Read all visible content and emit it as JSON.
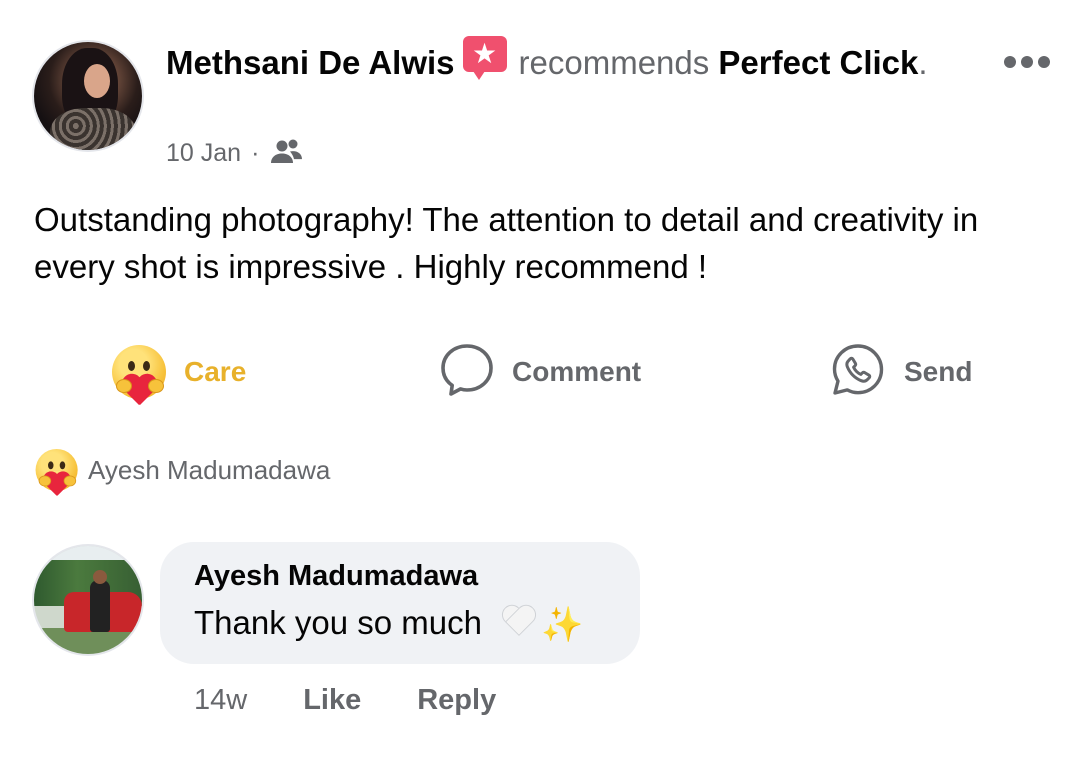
{
  "post": {
    "author_name": "Methsani De Alwis",
    "recommends_word": "recommends",
    "page_name": "Perfect Click",
    "trailing_period": ".",
    "date": "10 Jan",
    "separator": "·",
    "audience_icon": "friends-icon",
    "more_icon": "more-horizontal-icon",
    "body": "Outstanding photography! The attention to detail and creativity in every shot is impressive . Highly recommend !"
  },
  "actions": {
    "care_label": "Care",
    "comment_label": "Comment",
    "send_label": "Send"
  },
  "reactions": {
    "reactor_name": "Ayesh Madumadawa"
  },
  "comment": {
    "author": "Ayesh Madumadawa",
    "text": "Thank you so much",
    "time": "14w",
    "like_label": "Like",
    "reply_label": "Reply"
  },
  "colors": {
    "care": "#e8b12b",
    "muted": "#65676b",
    "recommend_badge": "#f0506e",
    "bubble_bg": "#f0f2f5"
  }
}
